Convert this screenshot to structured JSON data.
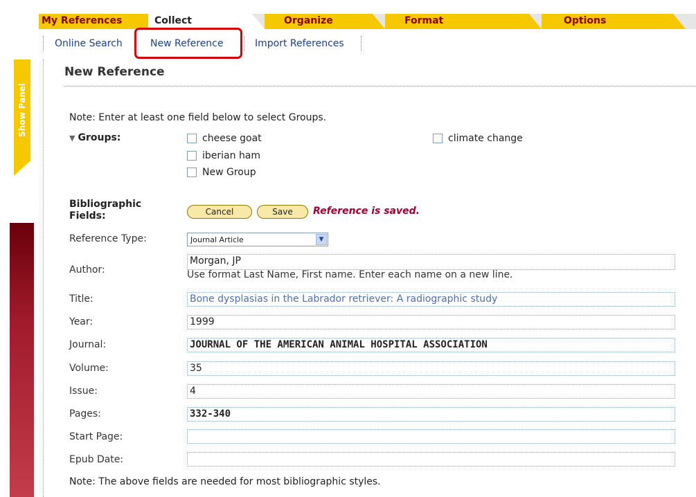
{
  "tabs": [
    {
      "label": "My References",
      "active": false
    },
    {
      "label": "Collect",
      "active": true
    },
    {
      "label": "Organize",
      "active": false
    },
    {
      "label": "Format",
      "active": false
    },
    {
      "label": "Options",
      "active": false
    }
  ],
  "subnav": [
    {
      "label": "Online Search"
    },
    {
      "label": "New Reference"
    },
    {
      "label": "Import References"
    }
  ],
  "side_panel": {
    "label": "Show Panel"
  },
  "page_title": "New Reference",
  "groups_note": "Note: Enter at least one field below to select Groups.",
  "groups": {
    "label": "Groups:",
    "items": [
      {
        "label": "cheese goat",
        "checked": false
      },
      {
        "label": "iberian ham",
        "checked": false
      },
      {
        "label": "New Group",
        "checked": false
      },
      {
        "label": "climate change",
        "checked": false
      }
    ]
  },
  "bibliographic": {
    "label": "Bibliographic Fields:",
    "cancel_label": "Cancel",
    "save_label": "Save",
    "saved_message": "Reference is saved."
  },
  "fields": {
    "reference_type": {
      "label": "Reference Type:",
      "value": "Journal Article"
    },
    "author": {
      "label": "Author:",
      "value": "Morgan, JP",
      "hint": "Use format Last Name, First name. Enter each name on a new line."
    },
    "title": {
      "label": "Title:",
      "value": "Bone dysplasias in the Labrador retriever: A radiographic study"
    },
    "year": {
      "label": "Year:",
      "value": "1999"
    },
    "journal": {
      "label": "Journal:",
      "value": "JOURNAL OF THE AMERICAN ANIMAL HOSPITAL ASSOCIATION"
    },
    "volume": {
      "label": "Volume:",
      "value": "35"
    },
    "issue": {
      "label": "Issue:",
      "value": "4"
    },
    "pages": {
      "label": "Pages:",
      "value": "332-340"
    },
    "start_page": {
      "label": "Start Page:",
      "value": ""
    },
    "epub_date": {
      "label": "Epub Date:",
      "value": ""
    }
  },
  "bottom_note": "Note: The above fields are needed for most bibliographic styles.",
  "colors": {
    "tab_yellow": "#f6c800",
    "tab_text": "#8b0000",
    "link_blue": "#1a3f8f",
    "highlight_red": "#d40000",
    "saved_red": "#a00030"
  }
}
